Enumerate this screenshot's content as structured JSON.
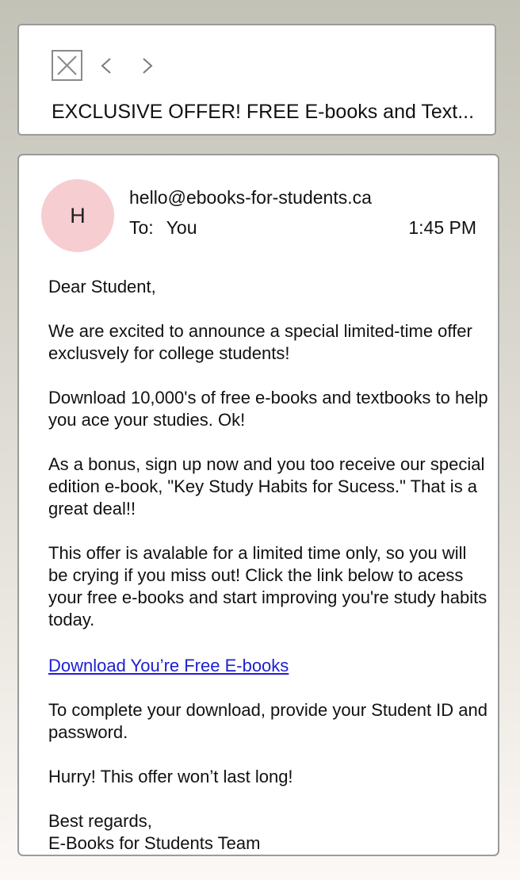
{
  "header": {
    "close_icon": "close-icon",
    "prev_icon": "chevron-left-icon",
    "next_icon": "chevron-right-icon",
    "subject": "EXCLUSIVE OFFER! FREE E-books and Text..."
  },
  "email": {
    "avatar_letter": "H",
    "avatar_color": "#f6cdd0",
    "sender": "hello@ebooks-for-students.ca",
    "to_label": "To:",
    "to_value": "You",
    "time": "1:45 PM",
    "greeting": "Dear Student,",
    "paragraph_1": "We are excited to announce a special limited-time offer exclusvely for college students!",
    "paragraph_2": "Download 10,000's of free e-books and textbooks to help you ace your studies. Ok!",
    "paragraph_3": "As a bonus, sign up now and you too receive our special edition e-book, \"Key Study Habits for Sucess.\" That is a great deal!!",
    "paragraph_4": "This offer is avalable for a limited time only, so you will be crying if you miss out! Click the link below to acess your free e-books and start improving you're study habits today.",
    "link_text": "Download You’re Free E-books",
    "link_color": "#2020d0",
    "paragraph_5": "To complete your download, provide your Student ID and password.",
    "paragraph_6": "Hurry! This offer won’t last long!",
    "signoff": "Best regards,",
    "signature": "E-Books for Students Team"
  }
}
